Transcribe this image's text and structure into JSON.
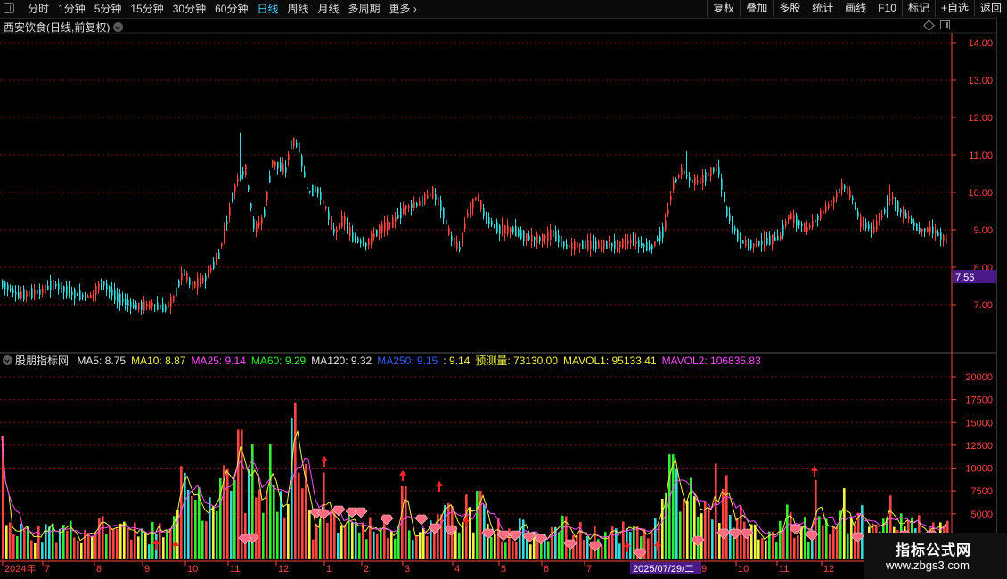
{
  "periods": [
    "分时",
    "1分钟",
    "5分钟",
    "15分钟",
    "30分钟",
    "60分钟",
    "日线",
    "周线",
    "月线",
    "多周期",
    "更多"
  ],
  "active_period": "日线",
  "tools": [
    "复权",
    "叠加",
    "多股",
    "统计",
    "画线",
    "F10",
    "标记",
    "+自选",
    "返回"
  ],
  "stock_title": "西安饮食(日线,前复权)",
  "price_axis": [
    "14.00",
    "13.00",
    "12.00",
    "11.00",
    "10.00",
    "9.00",
    "8.00",
    "7.00"
  ],
  "current_price": "7.56",
  "indicator": {
    "name": "股朋指标网",
    "items": [
      {
        "label": "MA5: 8.75",
        "color": "#e6e6e6"
      },
      {
        "label": "MA10: 8.87",
        "color": "#f3f345"
      },
      {
        "label": "MA25: 9.14",
        "color": "#ff4dff"
      },
      {
        "label": "MA60: 9.29",
        "color": "#33ee33"
      },
      {
        "label": "MA120: 9.32",
        "color": "#e6e6e6"
      },
      {
        "label": "MA250: 9.15",
        "color": "#3a5bff"
      },
      {
        "label": ": 9.14",
        "color": "#f3f345"
      },
      {
        "label": "预测量: 73130.00",
        "color": "#f3f345"
      },
      {
        "label": "MAVOL1: 95133.41",
        "color": "#f3f345"
      },
      {
        "label": "MAVOL2: 106835.83",
        "color": "#ff4dff"
      }
    ]
  },
  "volume_axis": [
    "20000",
    "17500",
    "15000",
    "12500",
    "10000",
    "7500",
    "5000"
  ],
  "date_axis": [
    "2024年",
    "7",
    "8",
    "9",
    "10",
    "11",
    "12",
    "1",
    "2",
    "3",
    "4",
    "5",
    "6",
    "7",
    "8",
    "9",
    "10",
    "11",
    "12"
  ],
  "date_highlight": "2025/07/29/二",
  "watermark": {
    "title": "指标公式网",
    "url": "www.zbgs3.com"
  },
  "colors": {
    "up": "#ff4444",
    "down": "#33dddd",
    "grid": "#7a1515",
    "axis": "#ff4444"
  }
}
